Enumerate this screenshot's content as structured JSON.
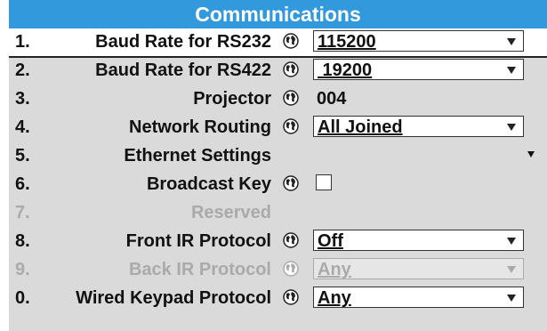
{
  "title": "Communications",
  "rows": [
    {
      "num": "1.",
      "label": "Baud Rate for RS232",
      "value": "115200"
    },
    {
      "num": "2.",
      "label": "Baud Rate for RS422",
      "value": " 19200"
    },
    {
      "num": "3.",
      "label": "Projector",
      "value": "004"
    },
    {
      "num": "4.",
      "label": "Network Routing",
      "value": "All Joined"
    },
    {
      "num": "5.",
      "label": "Ethernet Settings"
    },
    {
      "num": "6.",
      "label": "Broadcast Key"
    },
    {
      "num": "7.",
      "label": "Reserved"
    },
    {
      "num": "8.",
      "label": "Front IR Protocol",
      "value": "Off"
    },
    {
      "num": "9.",
      "label": "Back IR Protocol",
      "value": "Any"
    },
    {
      "num": "0.",
      "label": "Wired Keypad Protocol",
      "value": "Any"
    }
  ],
  "colors": {
    "title_bar": "#3399dd",
    "menu_bg": "#dadada",
    "disabled": "#aaaaaa"
  }
}
